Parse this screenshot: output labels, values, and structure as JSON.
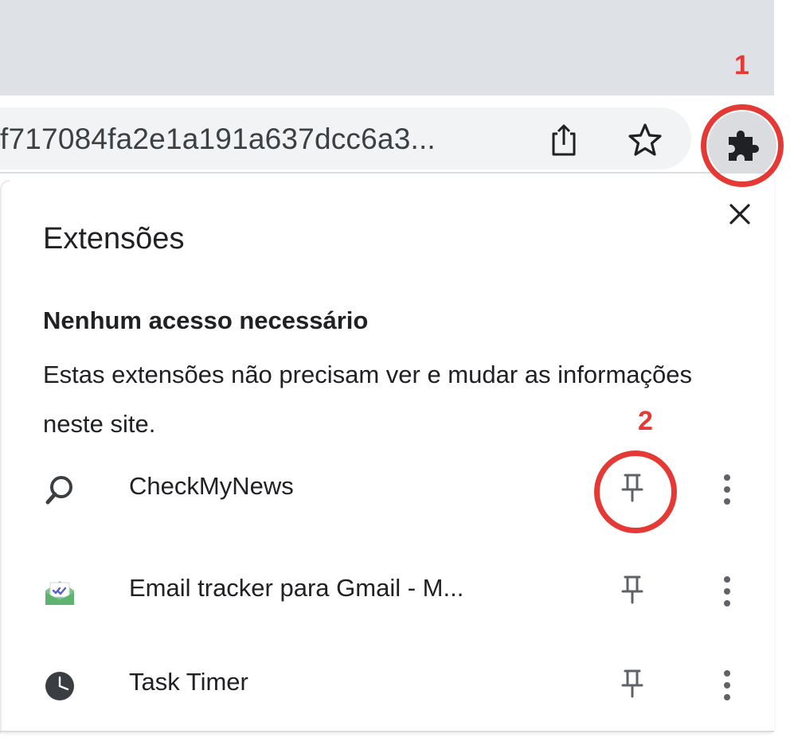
{
  "browser": {
    "url_text": "f717084fa2e1a191a637dcc6a3...",
    "share_icon": "share-icon",
    "bookmark_icon": "star-icon",
    "extensions_icon": "puzzle-icon"
  },
  "popup": {
    "title": "Extensões",
    "close_icon": "close-icon",
    "section_heading": "Nenhum acesso necessário",
    "section_description": "Estas extensões não precisam ver e mudar as informações neste site.",
    "extensions": [
      {
        "name": "CheckMyNews",
        "icon": "search-icon",
        "pin_icon": "pin-icon",
        "menu_icon": "more-vert-icon"
      },
      {
        "name": "Email tracker para Gmail - M...",
        "icon": "email-icon",
        "pin_icon": "pin-icon",
        "menu_icon": "more-vert-icon"
      },
      {
        "name": "Task Timer",
        "icon": "clock-icon",
        "pin_icon": "pin-icon",
        "menu_icon": "more-vert-icon"
      }
    ]
  },
  "annotations": {
    "marker_1": "1",
    "marker_2": "2",
    "color": "#e53935"
  },
  "colors": {
    "tab_strip": "#dee1e6",
    "omnibox": "#f1f3f4",
    "extension_button_active": "#dadce0",
    "text": "#202124",
    "icon": "#5f6368"
  }
}
